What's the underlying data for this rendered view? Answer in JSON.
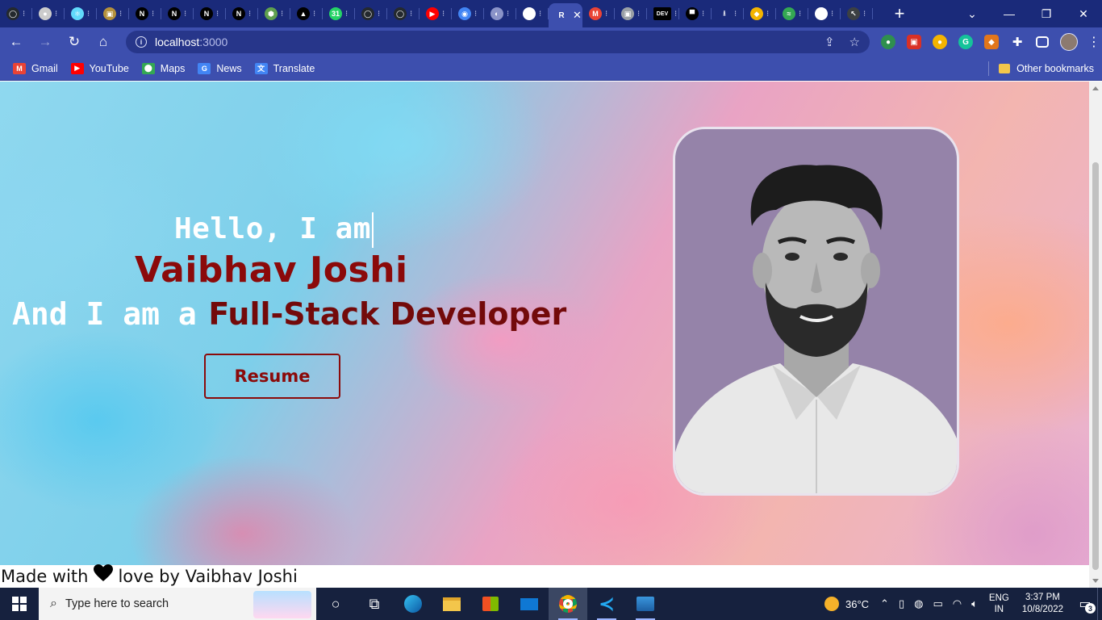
{
  "browser": {
    "tabs": [
      {
        "icon": "github-icon",
        "color": "#24292e",
        "glyph": "◯"
      },
      {
        "icon": "avatar-tab-icon",
        "color": "#cccccc",
        "glyph": "●"
      },
      {
        "icon": "react-icon",
        "color": "#61dafb",
        "glyph": "⚛"
      },
      {
        "icon": "photo-tab-icon",
        "color": "#b4903c",
        "glyph": "▣"
      },
      {
        "icon": "notion-icon",
        "color": "#000000",
        "glyph": "N"
      },
      {
        "icon": "notion-icon",
        "color": "#000000",
        "glyph": "N"
      },
      {
        "icon": "notion-icon",
        "color": "#000000",
        "glyph": "N"
      },
      {
        "icon": "notion-icon",
        "color": "#000000",
        "glyph": "N"
      },
      {
        "icon": "nodejs-icon",
        "color": "#5fa04e",
        "glyph": "⬢"
      },
      {
        "icon": "triangle-icon",
        "color": "#000000",
        "glyph": "▲"
      },
      {
        "icon": "whatsapp-icon",
        "color": "#25d366",
        "glyph": "31"
      },
      {
        "icon": "github-icon",
        "color": "#24292e",
        "glyph": "◯"
      },
      {
        "icon": "github-icon",
        "color": "#24292e",
        "glyph": "◯"
      },
      {
        "icon": "youtube-icon",
        "color": "#ff0000",
        "glyph": "▶"
      },
      {
        "icon": "chrome-icon",
        "color": "#4285f4",
        "glyph": "◉"
      },
      {
        "icon": "globe-icon",
        "color": "#8a93c8",
        "glyph": "◐"
      },
      {
        "icon": "globe-icon",
        "color": "#ffffff",
        "glyph": "◐"
      }
    ],
    "active_tab_glyph": "R",
    "tabs_after": [
      {
        "icon": "gmail-icon",
        "color": "#ea4335",
        "glyph": "M"
      },
      {
        "icon": "profile-tab-icon",
        "color": "#9aa0a6",
        "glyph": "▣"
      },
      {
        "icon": "dev-to-icon",
        "color": "#000000",
        "glyph": "DEV"
      },
      {
        "icon": "dark-tab-icon",
        "color": "#000000",
        "glyph": "▀"
      },
      {
        "icon": "download-icon",
        "color": "#1a2a7a",
        "glyph": "⭳"
      },
      {
        "icon": "shield-tab-icon",
        "color": "#f4b400",
        "glyph": "◆"
      },
      {
        "icon": "wave-tab-icon",
        "color": "#34a853",
        "glyph": "≈"
      },
      {
        "icon": "google-icon",
        "color": "#ffffff",
        "glyph": "G"
      },
      {
        "icon": "cursor-tab-icon",
        "color": "#3c4043",
        "glyph": "↖"
      }
    ],
    "url_host": "localhost",
    "url_port": ":3000",
    "bookmarks": [
      {
        "label": "Gmail",
        "icon": "gmail-icon",
        "color": "#ea4335",
        "glyph": "M"
      },
      {
        "label": "YouTube",
        "icon": "youtube-icon",
        "color": "#ff0000",
        "glyph": "▶"
      },
      {
        "label": "Maps",
        "icon": "maps-icon",
        "color": "#34a853",
        "glyph": "⬤"
      },
      {
        "label": "News",
        "icon": "news-icon",
        "color": "#4285f4",
        "glyph": "G"
      },
      {
        "label": "Translate",
        "icon": "translate-icon",
        "color": "#4285f4",
        "glyph": "文"
      }
    ],
    "other_bookmarks": "Other bookmarks"
  },
  "page": {
    "hello": "Hello, I am",
    "name": "Vaibhav Joshi",
    "tagline_lead": "And I am a",
    "tagline_role": "Full-Stack Developer",
    "resume_label": "Resume",
    "footer_before": "Made with",
    "footer_after": "love by Vaibhav Joshi",
    "name_color": "#8b0a0a",
    "role_color": "#730a0a"
  },
  "taskbar": {
    "search_placeholder": "Type here to search",
    "temperature": "36°C",
    "lang_line1": "ENG",
    "lang_line2": "IN",
    "time": "3:37 PM",
    "date": "10/8/2022",
    "notifications": "3"
  }
}
